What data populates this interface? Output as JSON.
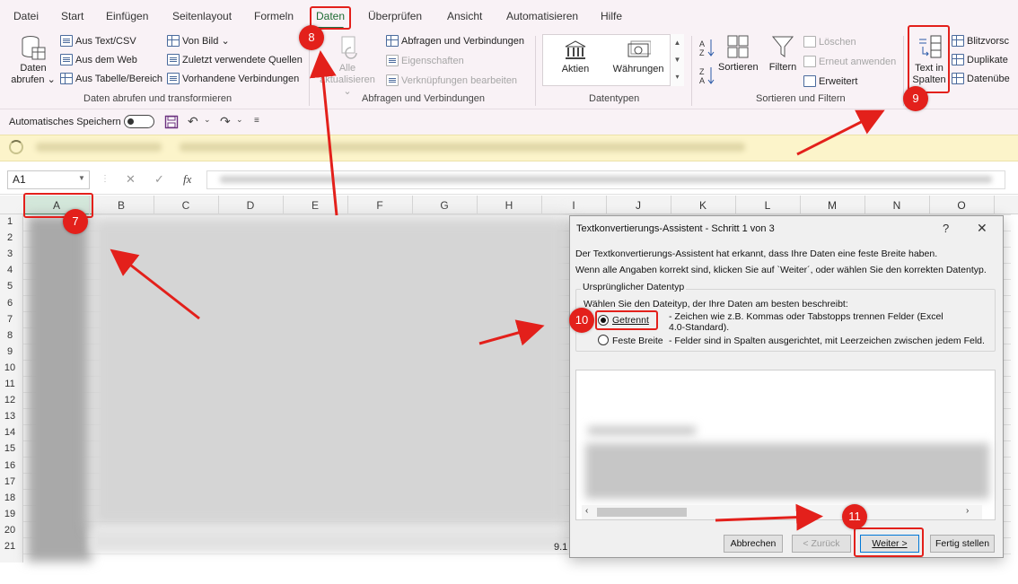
{
  "ribbon": {
    "tabs": [
      "Datei",
      "Start",
      "Einfügen",
      "Seitenlayout",
      "Formeln",
      "Daten",
      "Überprüfen",
      "Ansicht",
      "Automatisieren",
      "Hilfe"
    ],
    "active_tab": "Daten",
    "get_data": {
      "big_button_line1": "Daten",
      "big_button_line2": "abrufen",
      "items": [
        "Aus Text/CSV",
        "Aus dem Web",
        "Aus Tabelle/Bereich",
        "Von Bild",
        "Zuletzt verwendete Quellen",
        "Vorhandene Verbindungen"
      ],
      "group_label": "Daten abrufen und transformieren"
    },
    "queries": {
      "refresh_line1": "Alle",
      "refresh_line2": "aktualisieren",
      "items": [
        "Abfragen und Verbindungen",
        "Eigenschaften",
        "Verknüpfungen bearbeiten"
      ],
      "group_label": "Abfragen und Verbindungen"
    },
    "data_types": {
      "items": [
        "Aktien",
        "Währungen"
      ],
      "group_label": "Datentypen"
    },
    "sort_filter": {
      "sort_label": "Sortieren",
      "filter_label": "Filtern",
      "items": [
        "Löschen",
        "Erneut anwenden",
        "Erweitert"
      ],
      "group_label": "Sortieren und Filtern"
    },
    "data_tools": {
      "text_to_columns_line1": "Text in",
      "text_to_columns_line2": "Spalten",
      "items": [
        "Blitzvorsc",
        "Duplikate",
        "Datenübe"
      ]
    }
  },
  "qat": {
    "autosave_label": "Automatisches Speichern"
  },
  "formula_bar": {
    "name_box": "A1",
    "fx": "fx"
  },
  "sheet": {
    "columns": [
      "A",
      "B",
      "C",
      "D",
      "E",
      "F",
      "G",
      "H",
      "I",
      "J",
      "K",
      "L",
      "M",
      "N",
      "O"
    ],
    "rows": [
      "1",
      "2",
      "3",
      "4",
      "5",
      "6",
      "7",
      "8",
      "9",
      "10",
      "11",
      "12",
      "13",
      "14",
      "15",
      "16",
      "17",
      "18",
      "19",
      "20",
      "21"
    ],
    "cell_fragment": "9.1"
  },
  "dialog": {
    "title": "Textkonvertierungs-Assistent - Schritt 1 von 3",
    "help": "?",
    "close": "✕",
    "intro_line1": "Der Textkonvertierungs-Assistent hat erkannt, dass Ihre Daten eine feste Breite haben.",
    "intro_line2": "Wenn alle Angaben korrekt sind, klicken Sie auf `Weiter´, oder wählen Sie den korrekten Datentyp.",
    "fieldset_legend": "Ursprünglicher Datentyp",
    "fieldset_prompt": "Wählen Sie den Dateityp, der Ihre Daten am besten beschreibt:",
    "options": [
      {
        "label": "Getrennt",
        "desc_line1": "- Zeichen wie z.B. Kommas oder Tabstopps trennen Felder (Excel",
        "desc_line2": "4.0-Standard).",
        "checked": true
      },
      {
        "label": "Feste Breite",
        "desc_line1": "- Felder sind in Spalten ausgerichtet, mit Leerzeichen zwischen jedem Feld.",
        "desc_line2": "",
        "checked": false
      }
    ],
    "buttons": {
      "cancel": "Abbrechen",
      "back": "< Zurück",
      "next": "Weiter >",
      "finish": "Fertig stellen"
    }
  },
  "callouts": [
    "7",
    "8",
    "9",
    "10",
    "11"
  ],
  "colors": {
    "accent_green": "#1e7145",
    "callout_red": "#e3201b",
    "ribbon_bg": "#f9f2f6",
    "infobar_bg": "#fcf4ca"
  }
}
